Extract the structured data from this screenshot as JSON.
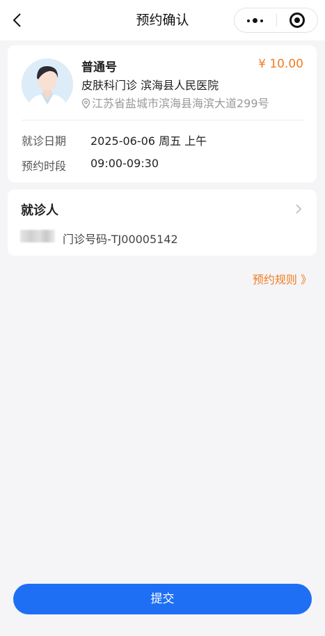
{
  "nav": {
    "title": "预约确认",
    "icons": [
      "back-chevron-icon",
      "more-dots-icon",
      "close-target-icon"
    ]
  },
  "doctor": {
    "name": "普通号",
    "price": "¥ 10.00",
    "department": "皮肤科门诊 滨海县人民医院",
    "address": "江苏省盐城市滨海县海滨大道299号",
    "avatar_icon": "doctor-avatar-icon"
  },
  "schedule": {
    "date_label": "就诊日期",
    "date_value": "2025-06-06 周五 上午",
    "time_label": "预约时段",
    "time_value": "09:00-09:30"
  },
  "patient": {
    "title": "就诊人",
    "clinic_number": "门诊号码-TJ00005142"
  },
  "rules_link": "预约规则 》",
  "submit_label": "提交",
  "colors": {
    "accent": "#1f6ff5",
    "price": "#f07c22",
    "background": "#f5f5f7"
  }
}
